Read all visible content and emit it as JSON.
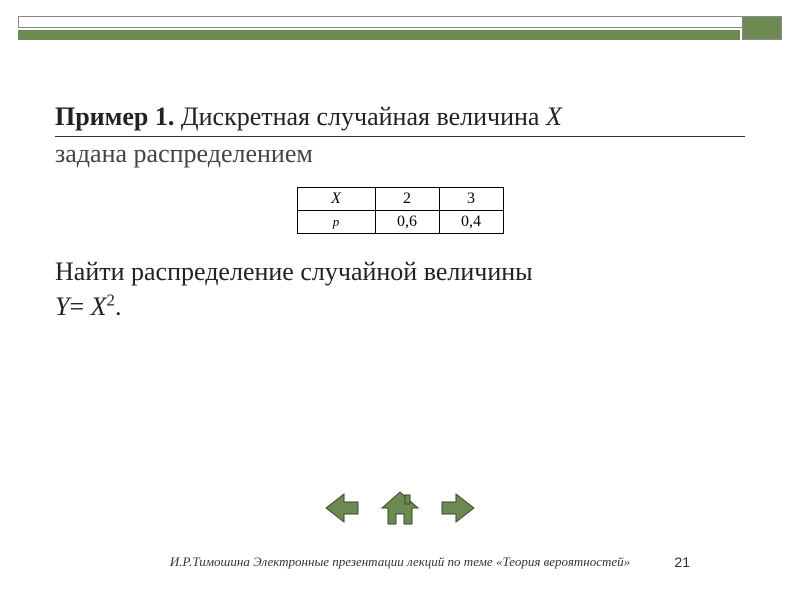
{
  "colors": {
    "accent": "#6d8a52",
    "border": "#888888"
  },
  "heading": {
    "label": "Пример 1.",
    "text_line1": " Дискретная случайная величина ",
    "var": "X",
    "text_line2": "задана распределением"
  },
  "table": {
    "row_labels": [
      "X",
      "p"
    ],
    "cols": [
      {
        "x": "2",
        "p": "0,6"
      },
      {
        "x": "3",
        "p": "0,4"
      }
    ]
  },
  "task": {
    "prefix": "Найти распределение случайной величины",
    "eq_lhs": "Y",
    "eq": "= ",
    "eq_rhs_base": "X",
    "eq_rhs_exp": "2",
    "suffix": "."
  },
  "nav": {
    "prev": "previous",
    "home": "home",
    "next": "next"
  },
  "footer": "И.Р.Тимошина Электронные презентации лекций по теме «Теория вероятностей»",
  "page": "21"
}
